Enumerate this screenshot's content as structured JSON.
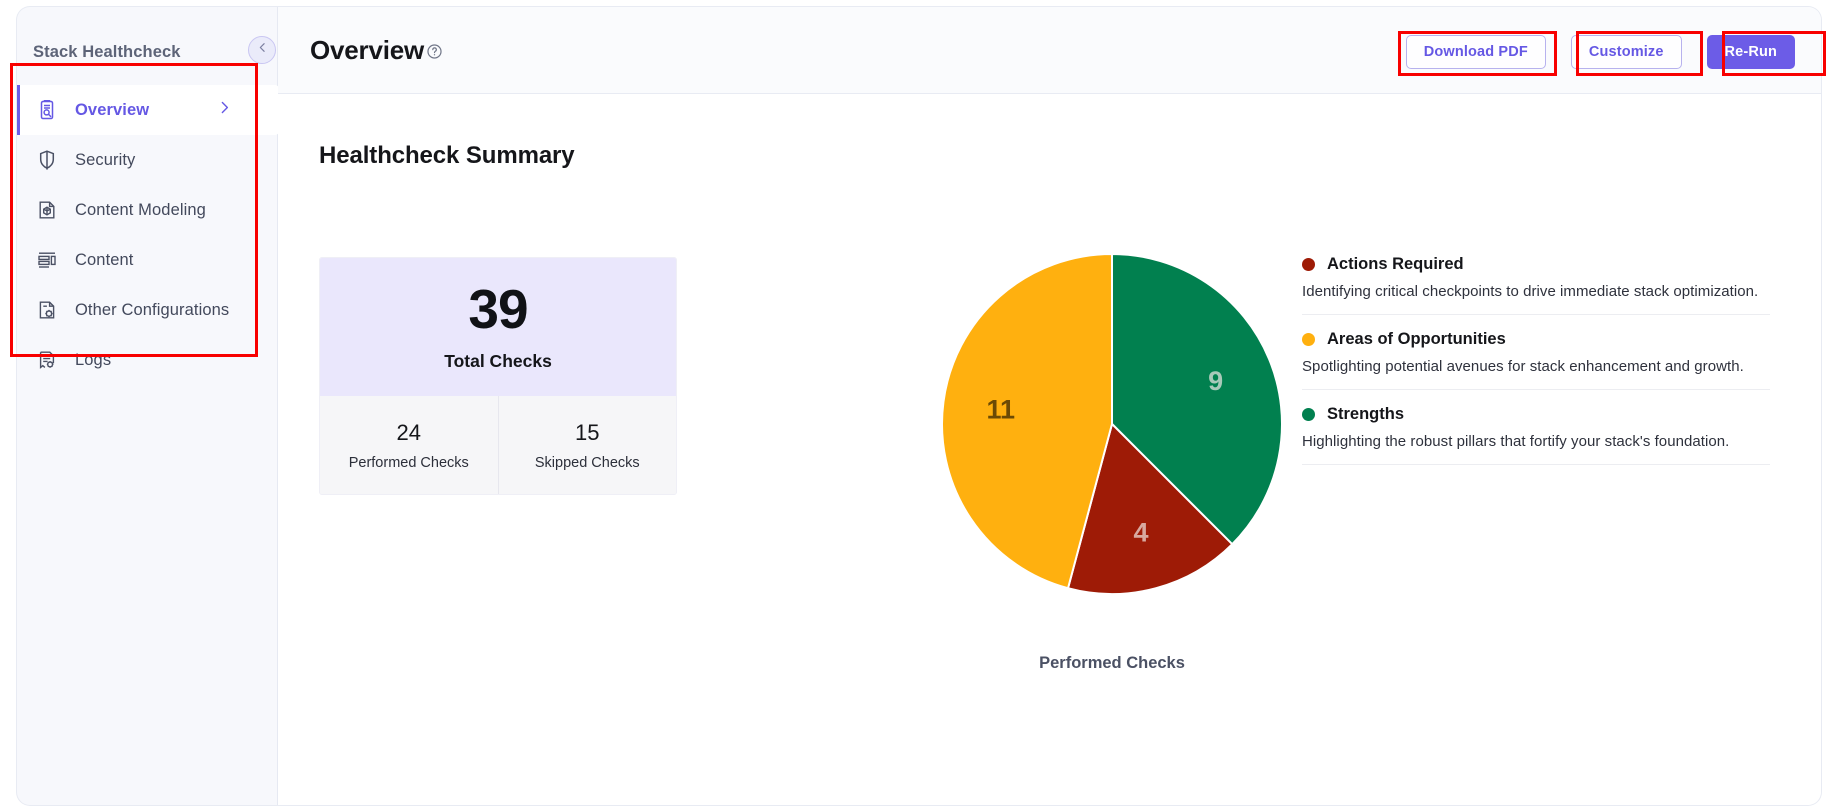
{
  "sidebar": {
    "title": "Stack Healthcheck",
    "items": [
      {
        "label": "Overview",
        "icon": "clipboard-search-icon",
        "active": true
      },
      {
        "label": "Security",
        "icon": "shield-icon",
        "active": false
      },
      {
        "label": "Content Modeling",
        "icon": "cube-document-icon",
        "active": false
      },
      {
        "label": "Content",
        "icon": "list-layout-icon",
        "active": false
      },
      {
        "label": "Other Configurations",
        "icon": "document-gear-icon",
        "active": false
      },
      {
        "label": "Logs",
        "icon": "log-gear-icon",
        "active": false
      }
    ],
    "collapse_icon": "chevron-left-icon",
    "active_chevron_icon": "chevron-right-icon"
  },
  "header": {
    "title": "Overview",
    "help_icon": "question-circle-icon",
    "buttons": [
      {
        "label": "Download PDF",
        "style": "outline"
      },
      {
        "label": "Customize",
        "style": "outline"
      },
      {
        "label": "Re-Run",
        "style": "primary"
      }
    ]
  },
  "main": {
    "section_title": "Healthcheck Summary",
    "stats": {
      "total_value": "39",
      "total_label": "Total Checks",
      "cells": [
        {
          "value": "24",
          "label": "Performed Checks"
        },
        {
          "value": "15",
          "label": "Skipped Checks"
        }
      ]
    },
    "legend": [
      {
        "title": "Actions Required",
        "desc": "Identifying critical checkpoints to drive immediate stack optimization.",
        "color": "#9E1B06"
      },
      {
        "title": "Areas of Opportunities",
        "desc": "Spotlighting potential avenues for stack enhancement and growth.",
        "color": "#FFB00F"
      },
      {
        "title": "Strengths",
        "desc": "Highlighting the robust pillars that fortify your stack's foundation.",
        "color": "#01804F"
      }
    ]
  },
  "chart_data": {
    "type": "pie",
    "title": "",
    "caption": "Performed Checks",
    "categories": [
      "Strengths",
      "Actions Required",
      "Areas of Opportunities"
    ],
    "values": [
      9,
      4,
      11
    ],
    "labels": [
      "9",
      "4",
      "11"
    ],
    "colors": [
      "#01804F",
      "#9E1B06",
      "#FFB00F"
    ],
    "label_colors": [
      "#A8C9B9",
      "#D8A99F",
      "#6B4A05"
    ],
    "total": 24,
    "legend_position": "right",
    "grid": false,
    "start_angle_deg": 0,
    "radius_px": 170
  },
  "colors": {
    "accent": "#6C5CE7",
    "accent_text": "#6558E4",
    "annotation": "#F80000",
    "sidebar_bg": "#F7F8FC",
    "card_purple": "#EAE7FC",
    "card_gray": "#F6F6F8"
  }
}
